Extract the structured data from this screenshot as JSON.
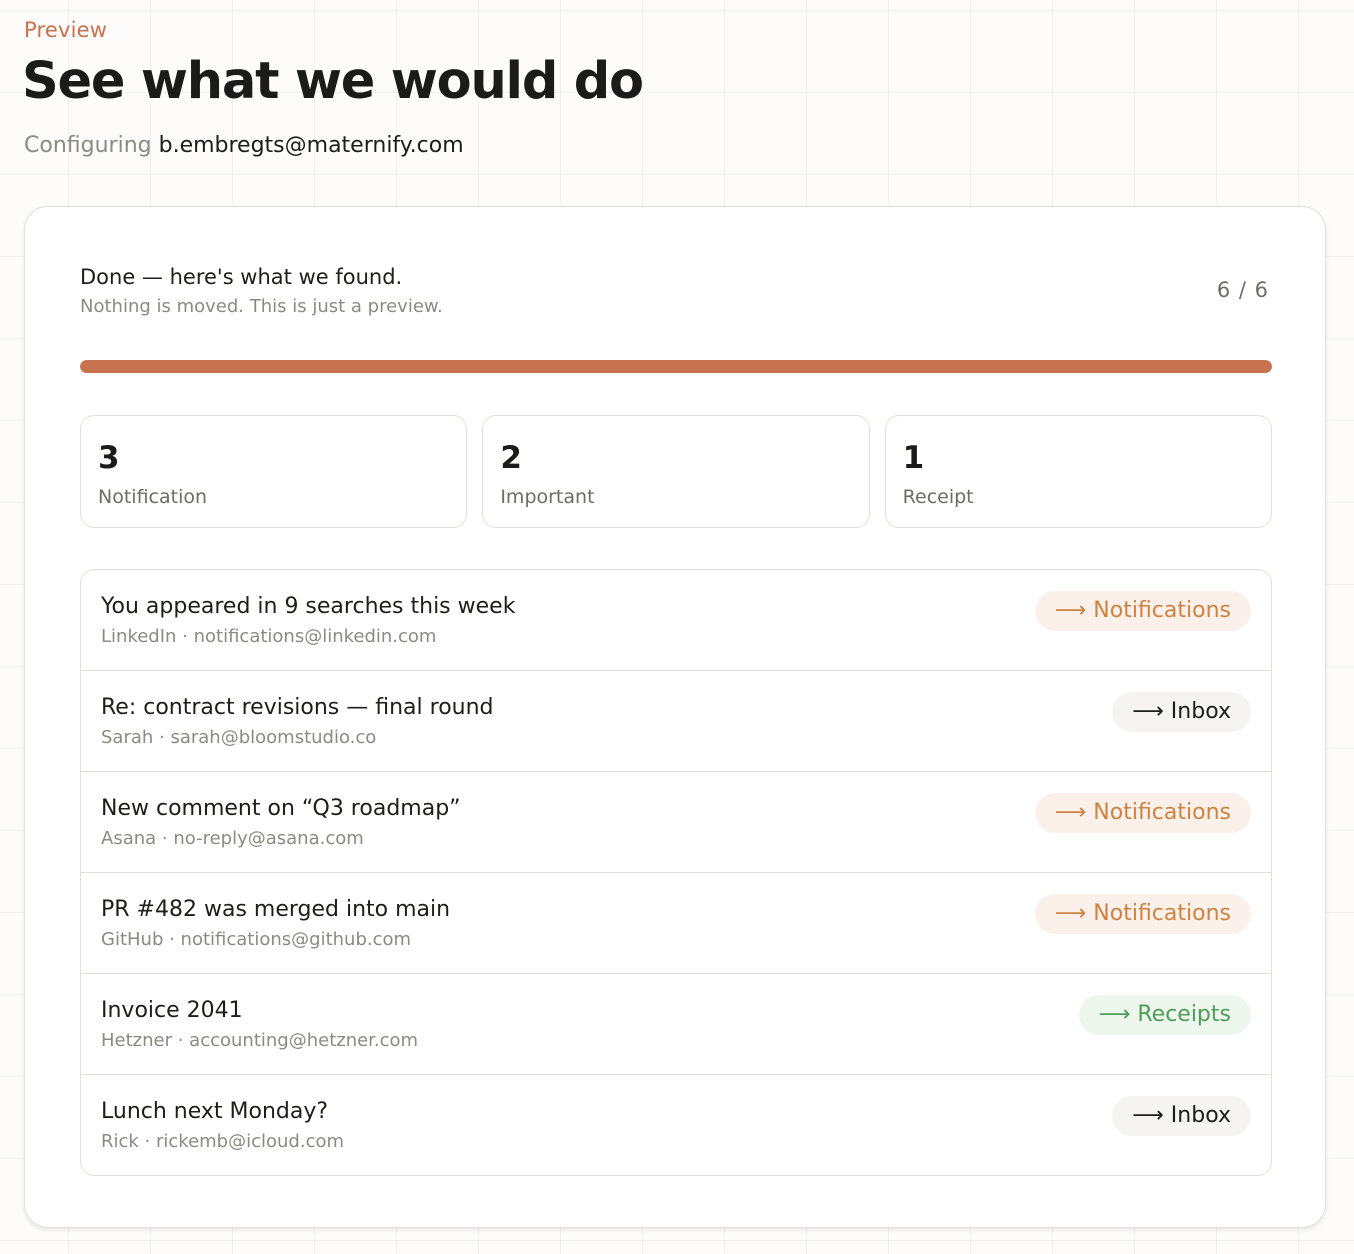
{
  "header": {
    "eyebrow": "Preview",
    "title": "See what we would do",
    "subtitle_prefix": "Configuring",
    "account_email": "b.embregts@maternify.com"
  },
  "status": {
    "title": "Done — here's what we found.",
    "subtitle": "Nothing is moved. This is just a preview.",
    "counter": "6 / 6",
    "progress_fraction": 1.0,
    "progress_color": "#c87350"
  },
  "stats": [
    {
      "count": "3",
      "label": "Notification"
    },
    {
      "count": "2",
      "label": "Important"
    },
    {
      "count": "1",
      "label": "Receipt"
    }
  ],
  "emails": [
    {
      "subject": "You appeared in 9 searches this week",
      "meta": "LinkedIn · notifications@linkedin.com",
      "action": "⟶ Notifications",
      "kind": "notifications"
    },
    {
      "subject": "Re: contract revisions — final round",
      "meta": "Sarah · sarah@bloomstudio.co",
      "action": "⟶ Inbox",
      "kind": "inbox"
    },
    {
      "subject": "New comment on “Q3 roadmap”",
      "meta": "Asana · no-reply@asana.com",
      "action": "⟶ Notifications",
      "kind": "notifications"
    },
    {
      "subject": "PR #482 was merged into main",
      "meta": "GitHub · notifications@github.com",
      "action": "⟶ Notifications",
      "kind": "notifications"
    },
    {
      "subject": "Invoice 2041",
      "meta": "Hetzner · accounting@hetzner.com",
      "action": "⟶ Receipts",
      "kind": "receipts"
    },
    {
      "subject": "Lunch next Monday?",
      "meta": "Rick · rickemb@icloud.com",
      "action": "⟶ Inbox",
      "kind": "inbox"
    }
  ],
  "colors": {
    "accent": "#c8714f",
    "notifications": "#cf8240",
    "receipts": "#4e9e57"
  }
}
